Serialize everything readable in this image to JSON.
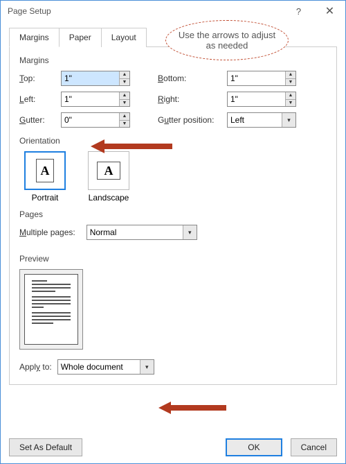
{
  "window": {
    "title": "Page Setup"
  },
  "tabs": {
    "margins": "Margins",
    "paper": "Paper",
    "layout": "Layout"
  },
  "margins": {
    "group_label": "Margins",
    "top_label": "Top:",
    "top_value": "1\"",
    "bottom_label": "Bottom:",
    "bottom_value": "1\"",
    "left_label": "Left:",
    "left_value": "1\"",
    "right_label": "Right:",
    "right_value": "1\"",
    "gutter_label": "Gutter:",
    "gutter_value": "0\"",
    "gutter_pos_label": "Gutter position:",
    "gutter_pos_value": "Left"
  },
  "orientation": {
    "group_label": "Orientation",
    "portrait": "Portrait",
    "landscape": "Landscape"
  },
  "pages": {
    "group_label": "Pages",
    "multiple_label": "Multiple pages:",
    "multiple_value": "Normal"
  },
  "preview": {
    "group_label": "Preview"
  },
  "apply": {
    "label": "Apply to:",
    "value": "Whole document"
  },
  "buttons": {
    "set_default": "Set As Default",
    "ok": "OK",
    "cancel": "Cancel"
  },
  "callout": {
    "text": "Use the arrows to adjust as needed"
  }
}
